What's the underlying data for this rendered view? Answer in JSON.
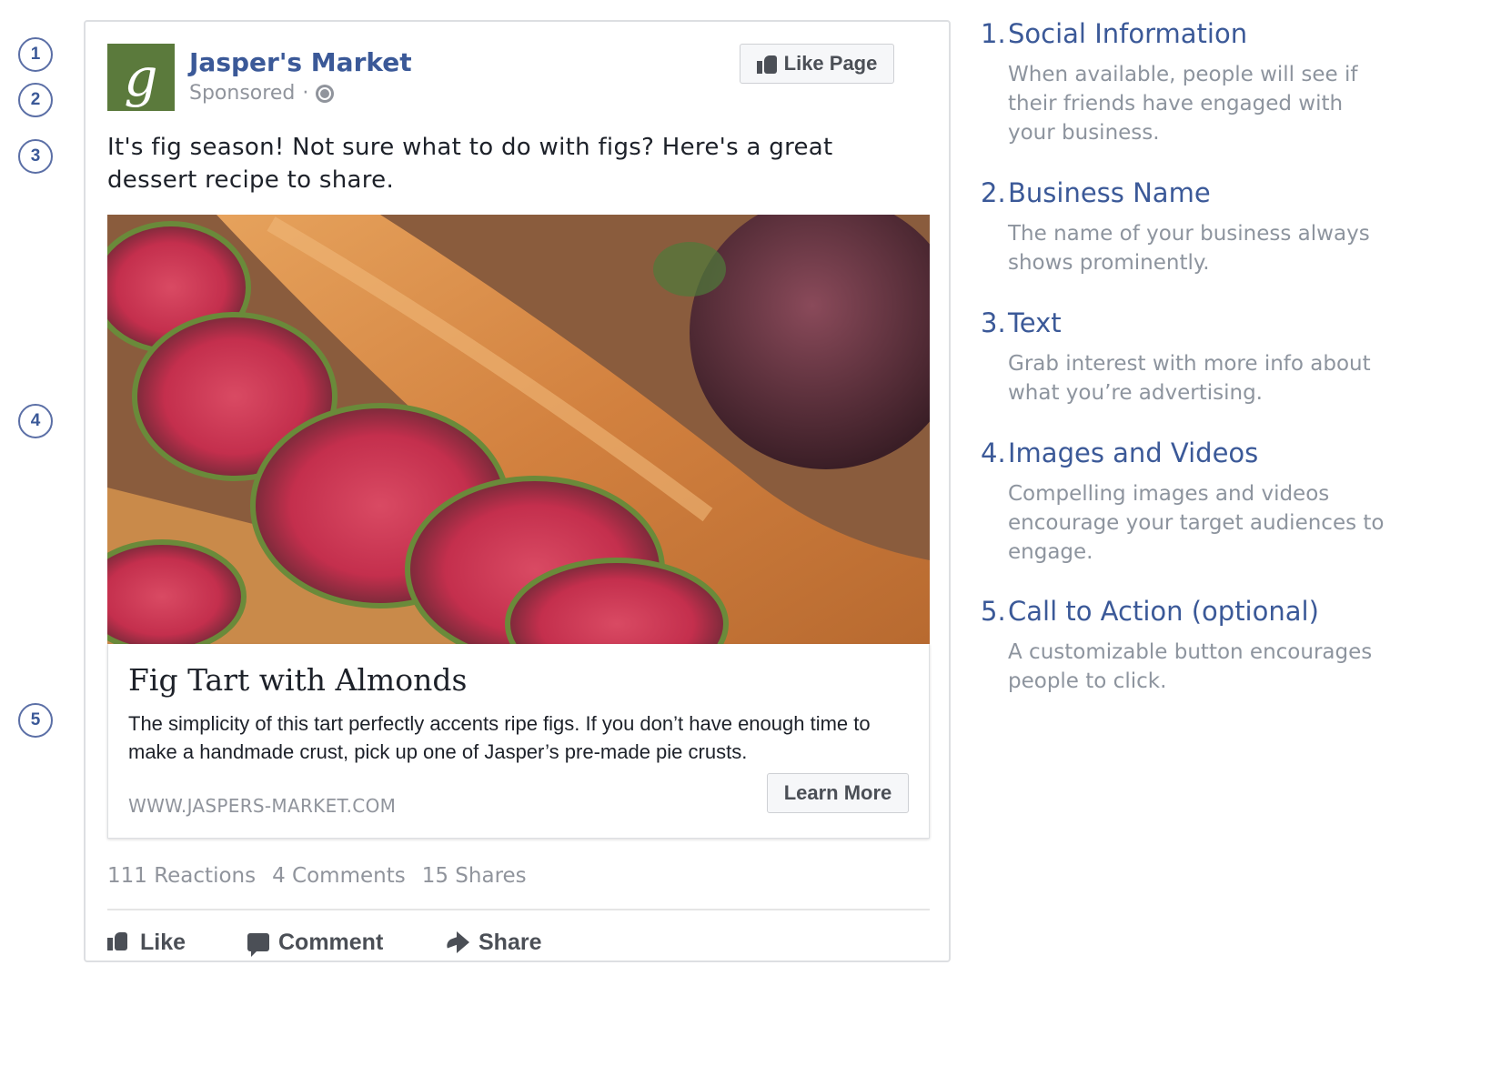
{
  "callouts": [
    "1",
    "2",
    "3",
    "4",
    "5"
  ],
  "ad": {
    "page_name": "Jasper's Market",
    "avatar_letter": "g",
    "sponsored": "Sponsored",
    "sponsored_sep": "·",
    "like_page": "Like Page",
    "post_text": "It's fig season! Not sure what to do with figs? Here's a great dessert recipe to share.",
    "link_title": "Fig Tart with Almonds",
    "link_description": "The simplicity of this tart perfectly accents ripe figs. If you don’t have enough time to make a handmade crust, pick up one of Jasper’s pre-made pie crusts.",
    "link_url": "WWW.JASPERS-MARKET.COM",
    "cta": "Learn More",
    "reactions": "111 Reactions",
    "comments": "4 Comments",
    "shares": "15 Shares",
    "actions": {
      "like": "Like",
      "comment": "Comment",
      "share": "Share"
    }
  },
  "descriptions": [
    {
      "num": "1.",
      "title": "Social Information",
      "body": "When available, people will see if their friends have engaged with your business."
    },
    {
      "num": "2.",
      "title": "Business Name",
      "body": "The name of your business always shows prominently."
    },
    {
      "num": "3.",
      "title": "Text",
      "body": "Grab interest with more info about what you’re advertising."
    },
    {
      "num": "4.",
      "title": "Images and Videos",
      "body": "Compelling images and videos encourage your target audiences to engage."
    },
    {
      "num": "5.",
      "title": "Call to Action (optional)",
      "body": "A customizable button encourages people to click."
    }
  ],
  "colors": {
    "brand": "#3b5998",
    "muted": "#90949c",
    "avatar": "#5b7a3c"
  }
}
